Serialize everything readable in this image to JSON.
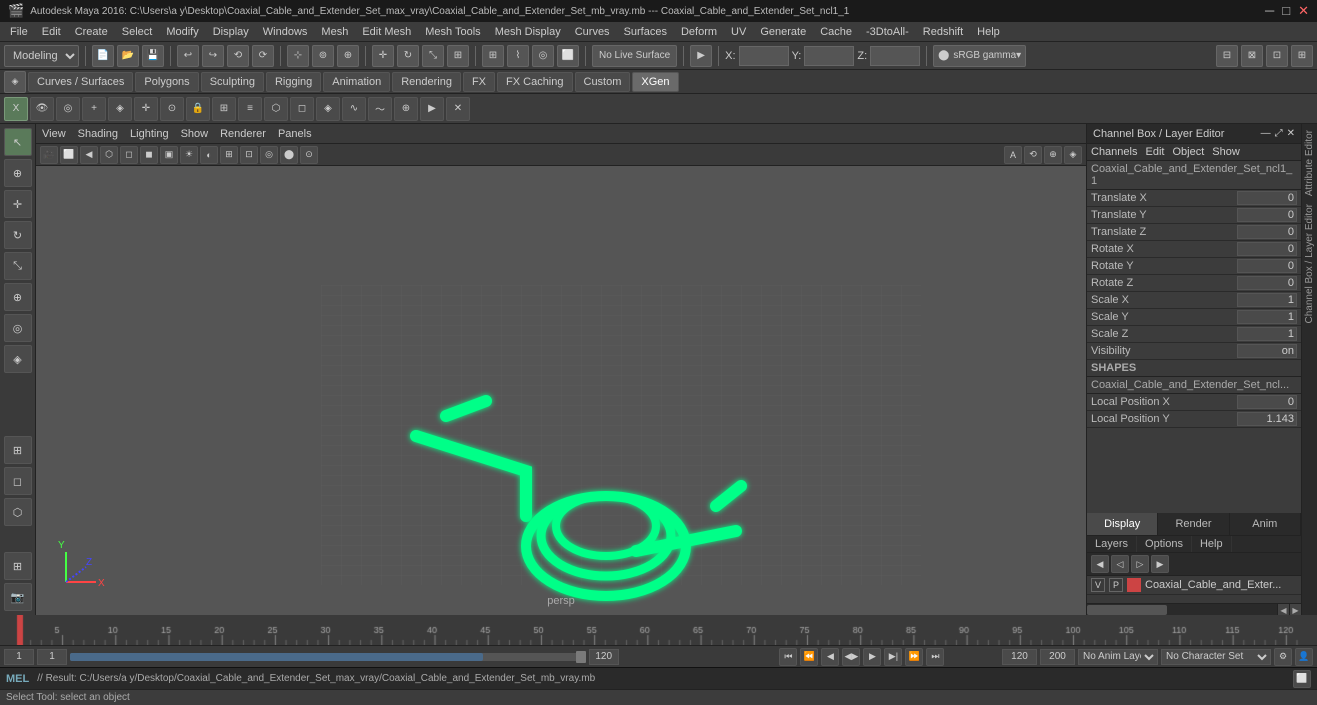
{
  "titleBar": {
    "appIcon": "maya-icon",
    "title": "Autodesk Maya 2016: C:\\Users\\a y\\Desktop\\Coaxial_Cable_and_Extender_Set_max_vray\\Coaxial_Cable_and_Extender_Set_mb_vray.mb  ---  Coaxial_Cable_and_Extender_Set_ncl1_1",
    "minimize": "─",
    "maximize": "□",
    "close": "✕"
  },
  "menuBar": {
    "items": [
      "File",
      "Edit",
      "Create",
      "Select",
      "Modify",
      "Display",
      "Windows",
      "Mesh",
      "Edit Mesh",
      "Mesh Tools",
      "Mesh Display",
      "Curves",
      "Surfaces",
      "Deform",
      "UV",
      "Generate",
      "Cache",
      "-3DtoAll-",
      "Redshift",
      "Help"
    ]
  },
  "toolbar1": {
    "dropdown": "Modeling",
    "buttons": [
      "new",
      "open",
      "save",
      "undo",
      "redo",
      "undo2",
      "redo2",
      "select",
      "lasso",
      "paint",
      "move",
      "rotate",
      "scale",
      "universal",
      "soft",
      "snap-grid",
      "snap-curve",
      "snap-point",
      "snap-view"
    ],
    "liveLabel": "No Live Surface",
    "xLabel": "X:",
    "xValue": "",
    "yLabel": "Y:",
    "yValue": "",
    "zLabel": "Z:",
    "zValue": "",
    "gammaLabel": "sRGB gamma"
  },
  "toolbar2": {
    "tabs": [
      {
        "label": "Curves / Surfaces",
        "active": false
      },
      {
        "label": "Polygons",
        "active": false
      },
      {
        "label": "Sculpting",
        "active": false
      },
      {
        "label": "Rigging",
        "active": false
      },
      {
        "label": "Animation",
        "active": false
      },
      {
        "label": "Rendering",
        "active": false
      },
      {
        "label": "FX",
        "active": false
      },
      {
        "label": "FX Caching",
        "active": false
      },
      {
        "label": "Custom",
        "active": false
      },
      {
        "label": "XGen",
        "active": true
      }
    ]
  },
  "iconToolbar": {
    "leftButtons": [
      "settings-icon"
    ],
    "icons": [
      "x-icon",
      "eye-icon",
      "camera-icon",
      "plus-icon",
      "select-icon",
      "move-icon",
      "eye2-icon",
      "lock-icon",
      "grid-icon",
      "light-icon",
      "wire-icon",
      "poly-icon",
      "nurbs-icon",
      "deform-icon",
      "anim-icon",
      "wave-icon",
      "brush-icon",
      "delete-icon"
    ]
  },
  "viewportHeader": {
    "menus": [
      "View",
      "Shading",
      "Lighting",
      "Show",
      "Renderer",
      "Panels"
    ]
  },
  "vpToolbar": {
    "buttons": [
      "cam-icon",
      "film-icon",
      "step-icon",
      "wireframe-icon",
      "solid-icon",
      "shaded-icon",
      "textured-icon",
      "light-icon",
      "shadow-icon",
      "grid-icon",
      "hud-icon",
      "isolate-icon",
      "resolution-icon",
      "xray-icon",
      "poly-count-icon",
      "fps-icon",
      "sync-icon",
      "snap-icon",
      "anim-icon",
      "camera-icon",
      "render-icon"
    ]
  },
  "viewport3d": {
    "label": "persp",
    "axisColors": {
      "x": "#ff4444",
      "y": "#44ff44",
      "z": "#4444ff"
    }
  },
  "channelBox": {
    "title": "Channel Box / Layer Editor",
    "menus": [
      "Channels",
      "Edit",
      "Object",
      "Show"
    ],
    "objectName": "Coaxial_Cable_and_Extender_Set_ncl1_1",
    "attributes": [
      {
        "label": "Translate X",
        "value": "0"
      },
      {
        "label": "Translate Y",
        "value": "0"
      },
      {
        "label": "Translate Z",
        "value": "0"
      },
      {
        "label": "Rotate X",
        "value": "0"
      },
      {
        "label": "Rotate Y",
        "value": "0"
      },
      {
        "label": "Rotate Z",
        "value": "0"
      },
      {
        "label": "Scale X",
        "value": "1"
      },
      {
        "label": "Scale Y",
        "value": "1"
      },
      {
        "label": "Scale Z",
        "value": "1"
      },
      {
        "label": "Visibility",
        "value": "on"
      }
    ],
    "shapesTitle": "SHAPES",
    "shapeName": "Coaxial_Cable_and_Extender_Set_ncl...",
    "shapeAttrs": [
      {
        "label": "Local Position X",
        "value": "0"
      },
      {
        "label": "Local Position Y",
        "value": "1.143"
      }
    ],
    "tabs": [
      {
        "label": "Display",
        "active": true
      },
      {
        "label": "Render",
        "active": false
      },
      {
        "label": "Anim",
        "active": false
      }
    ],
    "footerTabs": [
      {
        "label": "Layers",
        "active": false
      },
      {
        "label": "Options",
        "active": false
      },
      {
        "label": "Help",
        "active": false
      }
    ],
    "layers": [
      {
        "v": "V",
        "p": "P",
        "color": "#cc4444",
        "name": "Coaxial_Cable_and_Exter..."
      }
    ]
  },
  "attrStrip": {
    "labels": [
      "Attribute Editor",
      "Channel Box / Layer Editor"
    ]
  },
  "timeline": {
    "markers": [
      1,
      5,
      10,
      15,
      20,
      25,
      30,
      35,
      40,
      45,
      50,
      55,
      60,
      65,
      70,
      75,
      80,
      85,
      90,
      95,
      100,
      105,
      110,
      115,
      120
    ],
    "currentFrame": 1
  },
  "playback": {
    "currentFrame": "1",
    "startFrame": "1",
    "sliderValue": "120",
    "endFrame": "120",
    "totalFrames": "200",
    "animLayer": "No Anim Layer",
    "characterSet": "No Character Set",
    "buttons": {
      "skipToStart": "⏮",
      "stepBack": "⏪",
      "stepBackOne": "◀",
      "playBack": "◀▶",
      "playForward": "▶",
      "stepForwardOne": "▶",
      "stepForward": "⏩",
      "skipToEnd": "⏭"
    }
  },
  "statusBar": {
    "scriptType": "MEL",
    "result": "// Result: C:/Users/a y/Desktop/Coaxial_Cable_and_Extender_Set_max_vray/Coaxial_Cable_and_Extender_Set_mb_vray.mb"
  },
  "helpLine": {
    "text": "Select Tool: select an object"
  }
}
